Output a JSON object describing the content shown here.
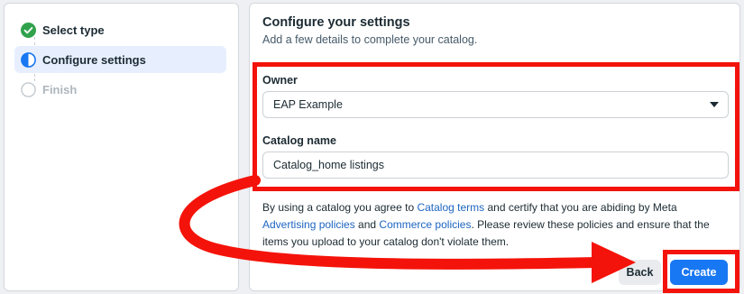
{
  "steps": [
    {
      "label": "Select type",
      "state": "done"
    },
    {
      "label": "Configure settings",
      "state": "active"
    },
    {
      "label": "Finish",
      "state": "todo"
    }
  ],
  "form": {
    "title": "Configure your settings",
    "subtitle": "Add a few details to complete your catalog.",
    "owner_label": "Owner",
    "owner_value": "EAP Example",
    "catalog_name_label": "Catalog name",
    "catalog_name_value": "Catalog_home listings"
  },
  "terms": {
    "t1": "By using a catalog you agree to ",
    "link_catalog_terms": "Catalog terms",
    "t2": " and certify that you are abiding by Meta ",
    "link_advertising": "Advertising policies",
    "t3": " and ",
    "link_commerce": "Commerce policies",
    "t4": ". Please review these policies and ensure that the items you upload to your catalog don't violate them."
  },
  "buttons": {
    "back": "Back",
    "create": "Create"
  },
  "colors": {
    "primary": "#1877f2",
    "annotation_red": "#f4130a",
    "success_green": "#31a24c",
    "active_step_bg": "#e7efff"
  }
}
